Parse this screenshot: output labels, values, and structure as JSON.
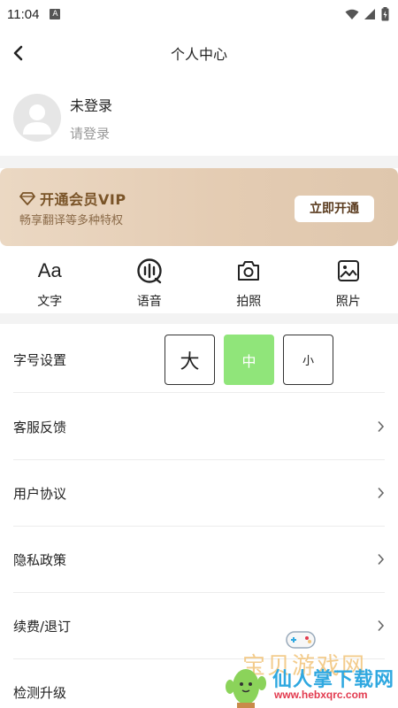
{
  "status_bar": {
    "time": "11:04",
    "notification_letter": "A"
  },
  "header": {
    "title": "个人中心"
  },
  "user": {
    "name": "未登录",
    "subtitle": "请登录"
  },
  "vip": {
    "title": "开通会员VIP",
    "subtitle": "畅享翻译等多种特权",
    "button_label": "立即开通",
    "accent_color": "#7a5428"
  },
  "features": [
    {
      "label": "文字",
      "icon": "text-icon",
      "glyph": "Aa"
    },
    {
      "label": "语音",
      "icon": "voice-icon"
    },
    {
      "label": "拍照",
      "icon": "camera-icon"
    },
    {
      "label": "照片",
      "icon": "photo-icon"
    }
  ],
  "font_size": {
    "label": "字号设置",
    "options": [
      {
        "label": "大"
      },
      {
        "label": "中"
      },
      {
        "label": "小"
      }
    ],
    "selected": "中",
    "active_color": "#90e57a"
  },
  "menu": [
    {
      "label": "客服反馈"
    },
    {
      "label": "用户协议"
    },
    {
      "label": "隐私政策"
    },
    {
      "label": "续费/退订"
    },
    {
      "label": "检测升级"
    }
  ],
  "watermark": {
    "line1": "宝贝游戏网",
    "line2": "仙人掌下载网",
    "url": "www.hebxqrc.com"
  }
}
